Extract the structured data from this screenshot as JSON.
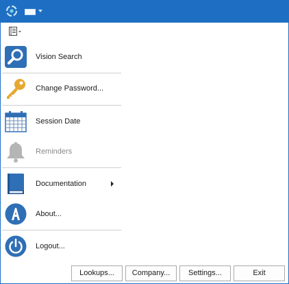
{
  "menu": {
    "items": [
      {
        "label": "Vision Search",
        "icon": "magnifier-icon",
        "enabled": true
      },
      {
        "label": "Change Password...",
        "icon": "key-icon",
        "enabled": true
      },
      {
        "label": "Session Date",
        "icon": "calendar-icon",
        "enabled": true
      },
      {
        "label": "Reminders",
        "icon": "bell-icon",
        "enabled": false
      },
      {
        "label": "Documentation",
        "icon": "book-icon",
        "enabled": true,
        "has_submenu": true
      },
      {
        "label": "About...",
        "icon": "info-a-icon",
        "enabled": true
      },
      {
        "label": "Logout...",
        "icon": "power-icon",
        "enabled": true
      }
    ]
  },
  "footer": {
    "lookups": "Lookups...",
    "company": "Company...",
    "settings": "Settings...",
    "exit": "Exit"
  },
  "colors": {
    "titlebar": "#1e6fc4",
    "accent_blue": "#2f6fb5",
    "key_gold": "#e7a830",
    "disabled_gray": "#b5b5b5"
  }
}
